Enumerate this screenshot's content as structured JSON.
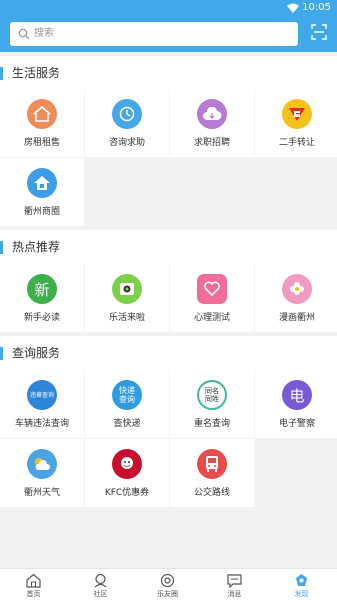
{
  "status": {
    "time": "10:05"
  },
  "search": {
    "placeholder": "搜索"
  },
  "sections": [
    {
      "title": "生活服务",
      "items": [
        {
          "label": "房租租售",
          "icon": "house-icon",
          "color": "#f08b5a"
        },
        {
          "label": "咨询求助",
          "icon": "chat-icon",
          "color": "#47a8e8"
        },
        {
          "label": "求职招聘",
          "icon": "cloud-icon",
          "color": "#b97ad6"
        },
        {
          "label": "二手转让",
          "icon": "superman-icon",
          "color": "#f5c21b"
        },
        {
          "label": "衢州商圈",
          "icon": "home-icon",
          "color": "#3d9de6"
        }
      ]
    },
    {
      "title": "热点推荐",
      "items": [
        {
          "label": "新手必读",
          "icon": "new-char-icon",
          "glyph": "新",
          "color": "#3cb04a"
        },
        {
          "label": "乐活来啦",
          "icon": "camera-icon",
          "color": "#7ed04a"
        },
        {
          "label": "心理测试",
          "icon": "heart-icon",
          "color": "#f06d9a"
        },
        {
          "label": "漫画衢州",
          "icon": "flower-icon",
          "color": "#f29ac1"
        }
      ]
    },
    {
      "title": "查询服务",
      "items": [
        {
          "label": "车辆违法查询",
          "icon": "violation-icon",
          "badge": "违章查询",
          "color": "#2f86d8"
        },
        {
          "label": "查快递",
          "icon": "express-icon",
          "badge": "快递查询",
          "color": "#2f9be0"
        },
        {
          "label": "重名查询",
          "icon": "same-name-icon",
          "badge": "同名同姓",
          "color": "#3cb9a0"
        },
        {
          "label": "电子警察",
          "icon": "electric-icon",
          "glyph": "电",
          "color": "#7a59d6"
        },
        {
          "label": "衢州天气",
          "icon": "weather-icon",
          "color": "#4aa3e5"
        },
        {
          "label": "KFC优惠券",
          "icon": "kfc-icon",
          "color": "#c8102e"
        },
        {
          "label": "公交路线",
          "icon": "bus-icon",
          "color": "#e84c4c"
        }
      ]
    }
  ],
  "tabs": [
    {
      "label": "首页",
      "icon": "home-tab-icon"
    },
    {
      "label": "社区",
      "icon": "community-icon"
    },
    {
      "label": "乐友圈",
      "icon": "circle-icon"
    },
    {
      "label": "消息",
      "icon": "message-icon"
    },
    {
      "label": "发现",
      "icon": "discover-icon"
    }
  ]
}
